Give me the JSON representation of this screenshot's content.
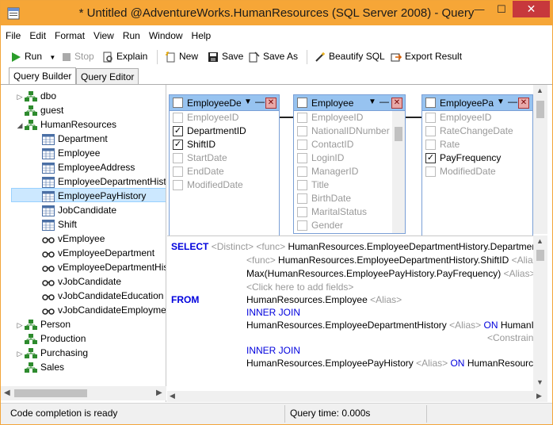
{
  "window": {
    "title": "* Untitled @AdventureWorks.HumanResources (SQL Server 2008) - Query",
    "minimize": "—",
    "maximize": "☐",
    "close": "✕"
  },
  "menu": [
    "File",
    "Edit",
    "Format",
    "View",
    "Run",
    "Window",
    "Help"
  ],
  "toolbar": {
    "run": "Run",
    "stop": "Stop",
    "explain": "Explain",
    "new": "New",
    "save": "Save",
    "save_as": "Save As",
    "beautify": "Beautify SQL",
    "export": "Export Result"
  },
  "tabs": [
    "Query Builder",
    "Query Editor"
  ],
  "tree": {
    "schemas_top": [
      "dbo",
      "guest",
      "HumanResources"
    ],
    "hr_tables": [
      "Department",
      "Employee",
      "EmployeeAddress",
      "EmployeeDepartmentHistory",
      "EmployeePayHistory",
      "JobCandidate",
      "Shift"
    ],
    "hr_views": [
      "vEmployee",
      "vEmployeeDepartment",
      "vEmployeeDepartmentHistory",
      "vJobCandidate",
      "vJobCandidateEducation",
      "vJobCandidateEmployment"
    ],
    "schemas_bottom": [
      "Person",
      "Production",
      "Purchasing",
      "Sales"
    ],
    "selected": "EmployeePayHistory"
  },
  "tables": [
    {
      "name": "EmployeeDe",
      "fields": [
        {
          "name": "EmployeeID",
          "checked": false
        },
        {
          "name": "DepartmentID",
          "checked": true
        },
        {
          "name": "ShiftID",
          "checked": true
        },
        {
          "name": "StartDate",
          "checked": false
        },
        {
          "name": "EndDate",
          "checked": false
        },
        {
          "name": "ModifiedDate",
          "checked": false
        }
      ]
    },
    {
      "name": "Employee",
      "fields": [
        {
          "name": "EmployeeID",
          "checked": false
        },
        {
          "name": "NationalIDNumber",
          "checked": false
        },
        {
          "name": "ContactID",
          "checked": false
        },
        {
          "name": "LoginID",
          "checked": false
        },
        {
          "name": "ManagerID",
          "checked": false
        },
        {
          "name": "Title",
          "checked": false
        },
        {
          "name": "BirthDate",
          "checked": false
        },
        {
          "name": "MaritalStatus",
          "checked": false
        },
        {
          "name": "Gender",
          "checked": false
        }
      ]
    },
    {
      "name": "EmployeePa",
      "fields": [
        {
          "name": "EmployeeID",
          "checked": false
        },
        {
          "name": "RateChangeDate",
          "checked": false
        },
        {
          "name": "Rate",
          "checked": false
        },
        {
          "name": "PayFrequency",
          "checked": true
        },
        {
          "name": "ModifiedDate",
          "checked": false
        }
      ]
    }
  ],
  "sql": {
    "select_kw": "SELECT",
    "distinct": "<Distinct>",
    "func": "<func>",
    "alias": "<Alias>",
    "col1": "HumanResources.EmployeeDepartmentHistory.Department",
    "col2": "HumanResources.EmployeeDepartmentHistory.ShiftID",
    "col3": "Max(HumanResources.EmployeePayHistory.PayFrequency)",
    "add_fields": "<Click here to add fields>",
    "from_kw": "FROM",
    "from_table": "HumanResources.Employee",
    "inner_join": "INNER JOIN",
    "join1": "HumanResources.EmployeeDepartmentHistory",
    "on_kw": "ON",
    "join1_on": "HumanI",
    "constraint": "<Constrains",
    "join2": "HumanResources.EmployeePayHistory",
    "join2_on": "HumanResource"
  },
  "status": {
    "left": "Code completion is ready",
    "right": "Query time: 0.000s"
  }
}
